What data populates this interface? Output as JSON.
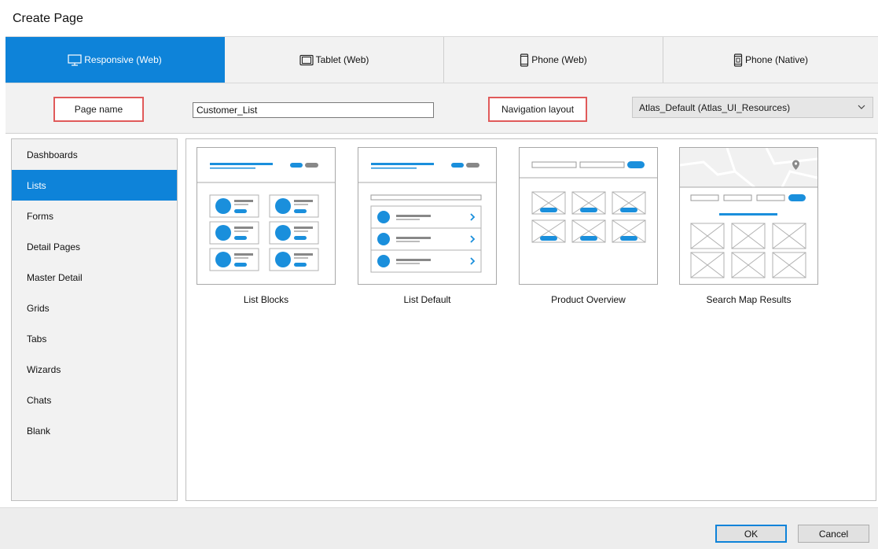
{
  "window": {
    "title": "Create Page"
  },
  "tabs": [
    {
      "label": "Responsive (Web)",
      "icon": "monitor-icon",
      "active": true
    },
    {
      "label": "Tablet (Web)",
      "icon": "tablet-icon",
      "active": false
    },
    {
      "label": "Phone (Web)",
      "icon": "phone-icon",
      "active": false
    },
    {
      "label": "Phone (Native)",
      "icon": "phone-native-icon",
      "active": false
    }
  ],
  "form": {
    "page_name_label": "Page name",
    "page_name_value": "Customer_List",
    "navigation_layout_label": "Navigation layout",
    "navigation_layout_value": "Atlas_Default (Atlas_UI_Resources)"
  },
  "categories": {
    "items": [
      {
        "label": "Dashboards"
      },
      {
        "label": "Lists",
        "selected": true
      },
      {
        "label": "Forms"
      },
      {
        "label": "Detail Pages"
      },
      {
        "label": "Master Detail"
      },
      {
        "label": "Grids"
      },
      {
        "label": "Tabs"
      },
      {
        "label": "Wizards"
      },
      {
        "label": "Chats"
      },
      {
        "label": "Blank"
      }
    ]
  },
  "templates": {
    "items": [
      {
        "label": "List Blocks"
      },
      {
        "label": "List Default"
      },
      {
        "label": "Product Overview"
      },
      {
        "label": "Search Map Results"
      }
    ]
  },
  "footer": {
    "ok_label": "OK",
    "cancel_label": "Cancel"
  },
  "colors": {
    "accent": "#0e83d9",
    "highlight_border": "#e05a5a",
    "panel_bg": "#f2f2f2"
  }
}
